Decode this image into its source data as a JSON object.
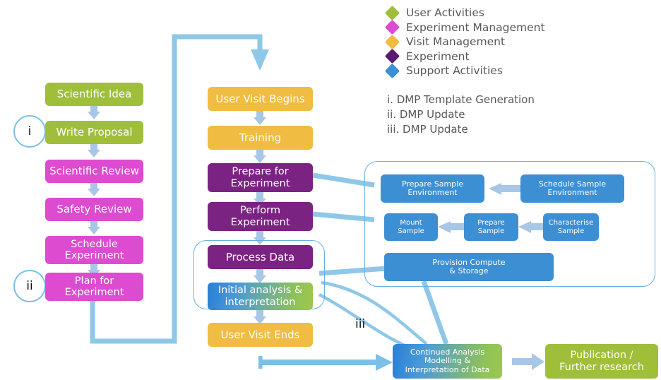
{
  "legend": {
    "items": [
      {
        "label": "User Activities",
        "color": "#9fbf3b",
        "icon": "diamond-icon"
      },
      {
        "label": "Experiment Management",
        "color": "#dd4bd0",
        "icon": "diamond-icon"
      },
      {
        "label": "Visit Management",
        "color": "#f0bc41",
        "icon": "diamond-icon"
      },
      {
        "label": "Experiment",
        "color": "#5c1a6e",
        "icon": "diamond-icon"
      },
      {
        "label": "Support Activities",
        "color": "#3d8fd4",
        "icon": "diamond-icon"
      }
    ]
  },
  "notes": [
    "i. DMP Template Generation",
    "ii. DMP Update",
    "iii. DMP Update"
  ],
  "markers": {
    "i": "i",
    "ii": "ii",
    "iii": "iii"
  },
  "proposal_column": {
    "nodes": [
      {
        "label": "Scientific Idea",
        "color": "user"
      },
      {
        "label": "Write Proposal",
        "color": "user"
      },
      {
        "label": "Scientific Review",
        "color": "management"
      },
      {
        "label": "Safety Review",
        "color": "management"
      },
      {
        "label": "Schedule\nExperiment",
        "color": "management"
      },
      {
        "label": "Plan for\nExperiment",
        "color": "management"
      }
    ]
  },
  "visit_column": {
    "nodes": [
      {
        "label": "User Visit Begins",
        "color": "visit"
      },
      {
        "label": "Training",
        "color": "visit"
      },
      {
        "label": "Prepare for\nExperiment",
        "color": "experiment"
      },
      {
        "label": "Perform\nExperiment",
        "color": "experiment"
      },
      {
        "label": "Process Data",
        "color": "experiment"
      },
      {
        "label": "Initial analysis &\ninterpretation",
        "color": "gradient"
      },
      {
        "label": "User Visit Ends",
        "color": "visit"
      }
    ]
  },
  "support_panel": {
    "nodes": [
      {
        "label": "Prepare Sample\nEnvironment",
        "color": "support"
      },
      {
        "label": "Schedule Sample\nEnvironment",
        "color": "support"
      },
      {
        "label": "Mount\nSample",
        "color": "support"
      },
      {
        "label": "Prepare\nSample",
        "color": "support"
      },
      {
        "label": "Characterise\nSample",
        "color": "support"
      },
      {
        "label": "Provision Compute\n& Storage",
        "color": "support"
      }
    ]
  },
  "outcome": {
    "nodes": [
      {
        "label": "Continued Analysis\nModelling &\nInterpretation of Data",
        "color": "gradient"
      },
      {
        "label": "Publication /\nFurther research",
        "color": "user"
      }
    ]
  },
  "colors": {
    "user": "#9fbf3b",
    "management": "#dd4bd0",
    "visit": "#f0bc41",
    "experiment": "#7b2382",
    "support": "#3d8fd4",
    "arrow": "#a8c6e5",
    "connector": "#8fc7e8",
    "text_grey": "#58585a",
    "panel_border": "#63b2e0"
  }
}
